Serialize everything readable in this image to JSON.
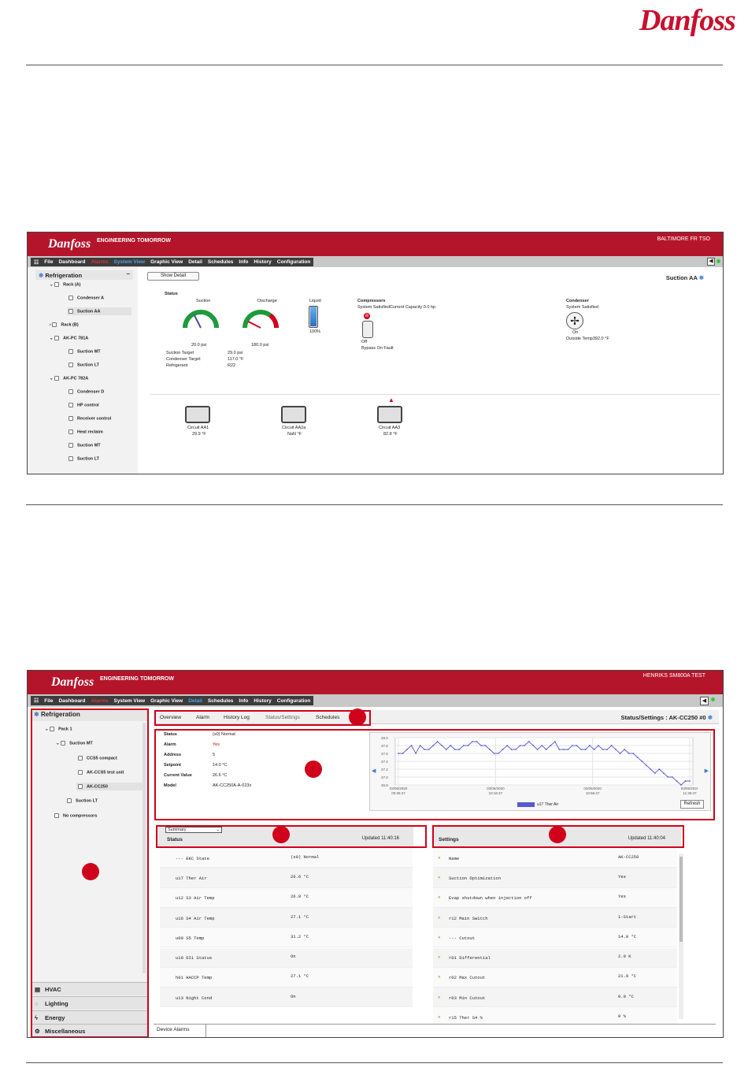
{
  "page_logo": "Danfoss",
  "shot1": {
    "header": {
      "logo": "Danfoss",
      "tagline": "ENGINEERING TOMORROW",
      "site": "BALTIMORE FR TSO"
    },
    "menu": [
      "File",
      "Dashboard",
      "Alarms",
      "System View",
      "Graphic View",
      "Detail",
      "Schedules",
      "Info",
      "History",
      "Configuration"
    ],
    "sidebar": {
      "title": "Refrigeration",
      "items": [
        "Rack (A)",
        "Condenser A",
        "Suction AA",
        "Rack (B)",
        "AK-PC 781A",
        "Suction MT",
        "Suction LT",
        "AK-PC 782A",
        "Condenser D",
        "HP control",
        "Receiver control",
        "Heat reclaim",
        "Suction MT",
        "Suction LT"
      ]
    },
    "show_detail_button": "Show Detail",
    "title": "Suction AA",
    "status_label": "Status",
    "suction": {
      "label": "Suction",
      "value": "20.0 psi",
      "level": 0.35
    },
    "discharge": {
      "label": "Discharge",
      "value": "180.0 psi",
      "level": 0.15
    },
    "liquid": {
      "label": "Liquid",
      "value": "100%",
      "level": 1.0
    },
    "info": [
      {
        "k": "Suction Target",
        "v": "29.0 psi"
      },
      {
        "k": "Condenser Target",
        "v": "117.0 °F"
      },
      {
        "k": "Refrigerant",
        "v": "R22"
      }
    ],
    "compressors": {
      "label": "Compressors",
      "status": "System SatisfiedCurrent Capacity 0.0 hp",
      "state": "Off",
      "fault": "Bypass On Fault"
    },
    "condenser": {
      "label": "Condenser",
      "status": "System Satisfied",
      "state": "On",
      "outside": "Outside Temp392.0 °F"
    },
    "circuits": [
      {
        "name": "Circuit AA1",
        "temp": "29.9 °F"
      },
      {
        "name": "Circuit AA2a",
        "temp": "NaN °F"
      },
      {
        "name": "Circuit AA3",
        "temp": "82.8 °F"
      }
    ]
  },
  "shot2": {
    "header": {
      "logo": "Danfoss",
      "tagline": "ENGINEERING TOMORROW",
      "site": "HENRIKS SM800A TEST"
    },
    "menu": [
      "File",
      "Dashboard",
      "Alarms",
      "System View",
      "Graphic View",
      "Detail",
      "Schedules",
      "Info",
      "History",
      "Configuration"
    ],
    "sidebar": {
      "title": "Refrigeration",
      "items": [
        "Pack 1",
        "Suction MT",
        "CCS5 compact",
        "AK-CCS5 test unit",
        "AK-CC250",
        "Suction LT",
        "No compressors"
      ],
      "accordion": [
        "HVAC",
        "Lighting",
        "Energy",
        "Miscellaneous"
      ]
    },
    "tabs": [
      "Overview",
      "Alarm",
      "History Log",
      "Status/Settings",
      "Schedules"
    ],
    "title": "Status/Settings : AK-CC250 #0",
    "status_info": [
      {
        "k": "Status",
        "v": "(s0) Normal"
      },
      {
        "k": "Alarm",
        "v": "Yes"
      },
      {
        "k": "Address",
        "v": "5"
      },
      {
        "k": "Setpoint",
        "v": "14.0 °C"
      },
      {
        "k": "Current Value",
        "v": "26.6 °C"
      },
      {
        "k": "Model",
        "v": "AK-CC250A-A-023x"
      }
    ],
    "chart_data": {
      "type": "line",
      "title": "",
      "yticks": [
        "28.0",
        "27.8",
        "27.6",
        "27.4",
        "27.2",
        "27.0",
        "26.8"
      ],
      "ylim": [
        26.8,
        28.0
      ],
      "xticks": [
        "03/06/2020 00:36:47",
        "03/06/2020 10:16:47",
        "03/06/2020 10:56:47",
        "03/06/2020 11:36:47"
      ],
      "series": [
        {
          "name": "u17 Ther Air",
          "color": "#5a5ad0",
          "values": [
            27.6,
            27.6,
            27.7,
            27.8,
            27.6,
            27.8,
            27.7,
            27.7,
            27.8,
            27.9,
            27.8,
            27.7,
            27.8,
            27.7,
            27.7,
            27.8,
            27.8,
            27.9,
            27.9,
            27.8,
            27.8,
            27.7,
            27.6,
            27.6,
            27.7,
            27.8,
            27.7,
            27.7,
            27.8,
            27.8,
            27.9,
            27.8,
            27.7,
            27.8,
            27.7,
            27.8,
            27.9,
            27.7,
            27.7,
            27.7,
            27.8,
            27.8,
            27.7,
            27.7,
            27.8,
            27.7,
            27.8,
            27.7,
            27.7,
            27.8,
            27.7,
            27.6,
            27.7,
            27.6,
            27.6,
            27.5,
            27.4,
            27.3,
            27.2,
            27.1,
            27.2,
            27.1,
            27.0,
            27.0,
            26.9,
            26.8,
            26.9,
            26.9
          ]
        }
      ]
    },
    "refresh": "Refresh",
    "status_panel": {
      "dropdown": "Summary",
      "title": "Status",
      "updated": "Updated 11:40:16",
      "rows": [
        {
          "k": "--- EKC State",
          "v": "(s0) Normal"
        },
        {
          "k": "u17 Ther Air",
          "v": "26.6 °C"
        },
        {
          "k": "u12 S3 Air Temp",
          "v": "26.0 °C"
        },
        {
          "k": "u16 S4 Air Temp",
          "v": "27.1 °C"
        },
        {
          "k": "u09 S5 Temp",
          "v": "31.2 °C"
        },
        {
          "k": "u10 DI1 Status",
          "v": "On"
        },
        {
          "k": "h01 HACCP Temp",
          "v": "27.1 °C"
        },
        {
          "k": "u13 Night Cond",
          "v": "On"
        }
      ]
    },
    "settings_panel": {
      "title": "Settings",
      "updated": "Updated 11:40:04",
      "rows": [
        {
          "k": "Name",
          "v": "AK-CC250"
        },
        {
          "k": "Suction Optimization",
          "v": "Yes"
        },
        {
          "k": "Evap shutdown when injection off",
          "v": "Yes"
        },
        {
          "k": "r12 Main Switch",
          "v": "1-Start"
        },
        {
          "k": "--- Cutout",
          "v": "14.0 °C"
        },
        {
          "k": "r01 Differential",
          "v": "2.0 K"
        },
        {
          "k": "r02 Max Cutout",
          "v": "21.9 °C"
        },
        {
          "k": "r03 Min Cutout",
          "v": "0.0 °C"
        },
        {
          "k": "r15 Ther S4 %",
          "v": "0 %"
        }
      ]
    },
    "footer_tab": "Device Alarms",
    "colors": {
      "brand": "#b5152b",
      "highlight": "#d0021b",
      "series": "#5a5ad0"
    }
  }
}
